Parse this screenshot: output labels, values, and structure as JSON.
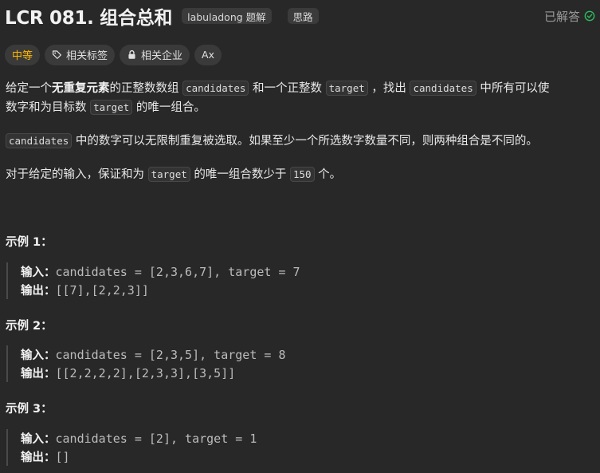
{
  "header": {
    "title": "LCR 081. 组合总和",
    "badge_labuladong": "labuladong 题解",
    "badge_idea": "思路",
    "solved_label": "已解答"
  },
  "tags": {
    "difficulty": "中等",
    "related_tags": "相关标签",
    "related_companies": "相关企业",
    "translate": "Ax"
  },
  "description": {
    "p1": {
      "t1": "给定一个",
      "b1": "无重复元素",
      "t2": "的正整数数组",
      "c1": "candidates",
      "t3": "和一个正整数",
      "c2": "target",
      "t4": "，找出",
      "c3": "candidates",
      "t5": "中所有可以使",
      "t6": "数字和为目标数",
      "c4": "target",
      "t7": "的唯一组合。"
    },
    "p2": {
      "c1": "candidates",
      "t1": "中的数字可以无限制重复被选取。如果至少一个所选数字数量不同，则两种组合是不同的。"
    },
    "p3": {
      "t1": "对于给定的输入，保证和为",
      "c1": "target",
      "t2": "的唯一组合数少于",
      "c2": "150",
      "t3": "个。"
    }
  },
  "examples": [
    {
      "title": "示例 1：",
      "input_label": "输入：",
      "input": "candidates = [2,3,6,7], target = 7",
      "output_label": "输出：",
      "output": "[[7],[2,2,3]]"
    },
    {
      "title": "示例 2：",
      "input_label": "输入：",
      "input": "candidates = [2,3,5], target = 8",
      "output_label": "输出：",
      "output": "[[2,2,2,2],[2,3,3],[3,5]]"
    },
    {
      "title": "示例 3：",
      "input_label": "输入：",
      "input": "candidates = [2], target = 1",
      "output_label": "输出：",
      "output": "[]"
    }
  ],
  "colors": {
    "background": "#282828",
    "difficulty_medium": "#ffb800",
    "solved_check": "#2cbb5d"
  }
}
